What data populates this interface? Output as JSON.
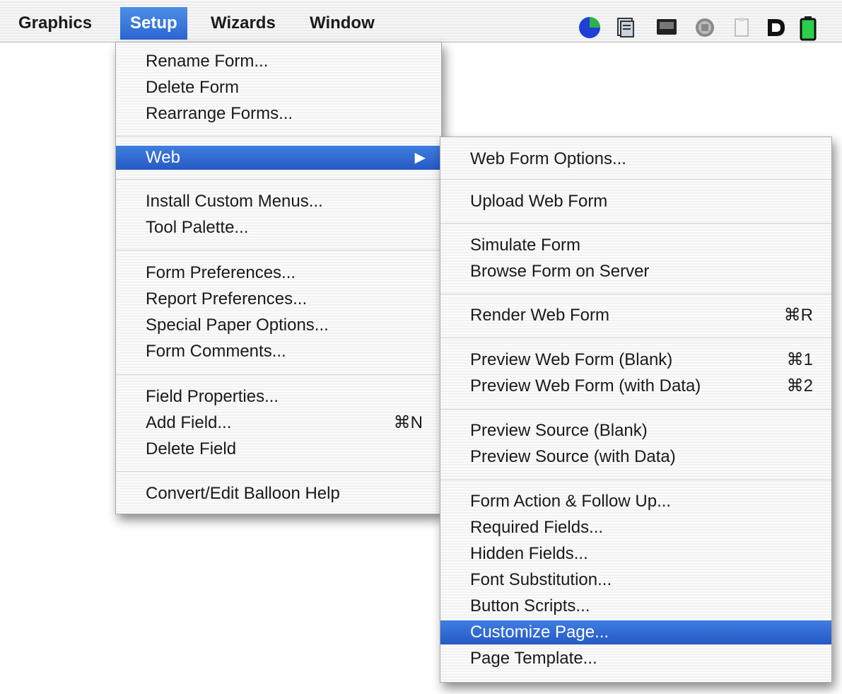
{
  "menubar": {
    "items": [
      {
        "label": "Graphics"
      },
      {
        "label": "Setup"
      },
      {
        "label": "Wizards"
      },
      {
        "label": "Window"
      }
    ],
    "status_icons": [
      "pie-chart-icon",
      "script-icon",
      "display-icon",
      "globe-icon",
      "clipboard-icon",
      "d-letter-icon",
      "battery-icon"
    ]
  },
  "setup_menu": {
    "items": [
      {
        "label": "Rename Form...",
        "shortcut": ""
      },
      {
        "label": "Delete Form",
        "shortcut": ""
      },
      {
        "label": "Rearrange Forms...",
        "shortcut": ""
      },
      {
        "label": "Web",
        "shortcut": ""
      },
      {
        "label": "Install Custom Menus...",
        "shortcut": ""
      },
      {
        "label": "Tool Palette...",
        "shortcut": ""
      },
      {
        "label": "Form Preferences...",
        "shortcut": ""
      },
      {
        "label": "Report Preferences...",
        "shortcut": ""
      },
      {
        "label": "Special Paper Options...",
        "shortcut": ""
      },
      {
        "label": "Form Comments...",
        "shortcut": ""
      },
      {
        "label": "Field Properties...",
        "shortcut": ""
      },
      {
        "label": "Add Field...",
        "shortcut": "⌘N"
      },
      {
        "label": "Delete Field",
        "shortcut": ""
      },
      {
        "label": "Convert/Edit Balloon Help",
        "shortcut": ""
      }
    ],
    "submenu_arrow": "▶"
  },
  "web_submenu": {
    "items": [
      {
        "label": "Web Form Options...",
        "shortcut": ""
      },
      {
        "label": "Upload Web Form",
        "shortcut": ""
      },
      {
        "label": "Simulate Form",
        "shortcut": ""
      },
      {
        "label": "Browse Form on Server",
        "shortcut": ""
      },
      {
        "label": "Render Web Form",
        "shortcut": "⌘R"
      },
      {
        "label": "Preview Web Form (Blank)",
        "shortcut": "⌘1"
      },
      {
        "label": "Preview Web Form (with Data)",
        "shortcut": "⌘2"
      },
      {
        "label": "Preview Source (Blank)",
        "shortcut": ""
      },
      {
        "label": "Preview Source (with Data)",
        "shortcut": ""
      },
      {
        "label": "Form Action & Follow Up...",
        "shortcut": ""
      },
      {
        "label": "Required Fields...",
        "shortcut": ""
      },
      {
        "label": "Hidden Fields...",
        "shortcut": ""
      },
      {
        "label": "Font Substitution...",
        "shortcut": ""
      },
      {
        "label": "Button Scripts...",
        "shortcut": ""
      },
      {
        "label": "Customize Page...",
        "shortcut": ""
      },
      {
        "label": "Page Template...",
        "shortcut": ""
      }
    ]
  },
  "colors": {
    "selection": "#2f6bd3",
    "menu_bg": "#f6f6f6"
  }
}
